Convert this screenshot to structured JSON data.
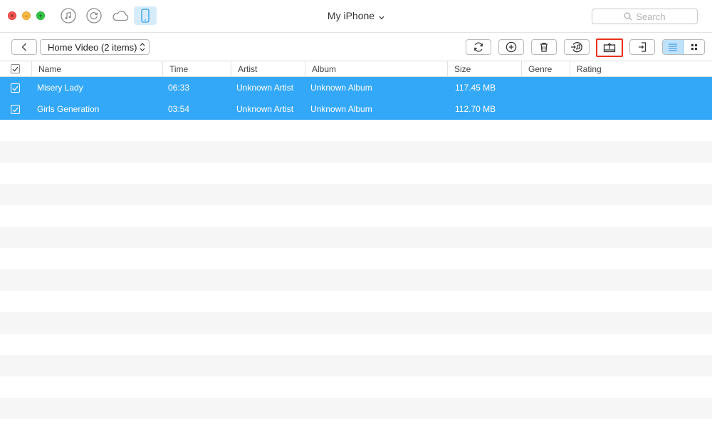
{
  "window": {
    "title": "My iPhone"
  },
  "search": {
    "placeholder": "Search"
  },
  "toolbar": {
    "category_select": "Home Video (2 items)"
  },
  "table": {
    "columns": [
      "Name",
      "Time",
      "Artist",
      "Album",
      "Size",
      "Genre",
      "Rating"
    ],
    "rows": [
      {
        "name": "Misery Lady",
        "time": "06:33",
        "artist": "Unknown Artist",
        "album": "Unknown Album",
        "size": "117.45 MB",
        "genre": "",
        "rating": "",
        "checked": true
      },
      {
        "name": "Girls Generation",
        "time": "03:54",
        "artist": "Unknown Artist",
        "album": "Unknown Album",
        "size": "112.70 MB",
        "genre": "",
        "rating": "",
        "checked": true
      }
    ]
  },
  "icons": {
    "nav": [
      "music-note-icon",
      "history-icon",
      "cloud-icon",
      "phone-icon"
    ],
    "actions": [
      "refresh-icon",
      "add-icon",
      "delete-icon",
      "to-itunes-icon",
      "to-computer-icon",
      "to-device-icon"
    ],
    "views": [
      "list-view-icon",
      "grid-view-icon"
    ]
  },
  "colors": {
    "selection": "#34a8f8",
    "highlight_border": "#e8321c",
    "active_view": "#bfe1fa",
    "active_nav": "#d6ecfb"
  }
}
